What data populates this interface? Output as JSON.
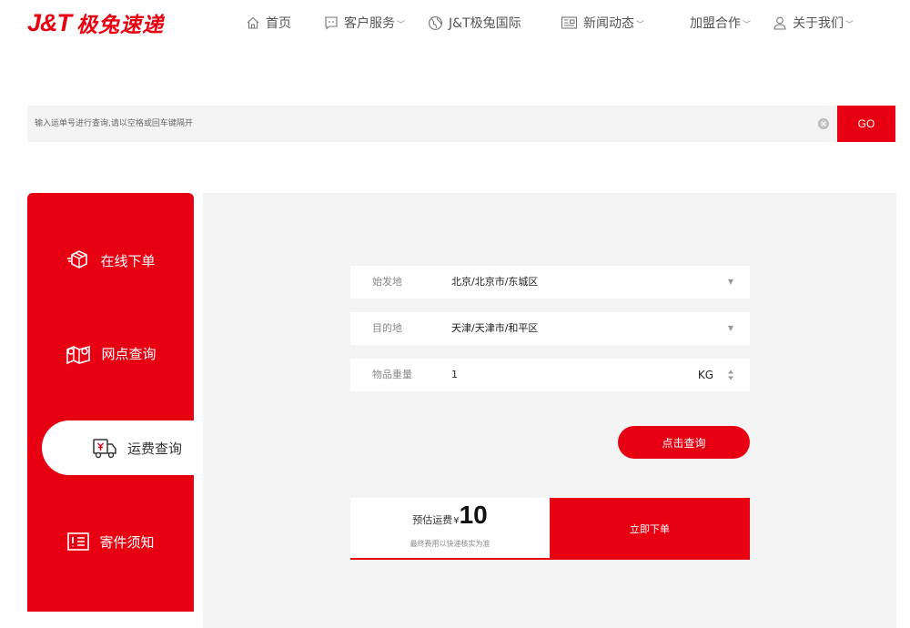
{
  "header": {
    "logo_latin": "J&T",
    "logo_cn": "极兔速递",
    "nav": [
      {
        "label": "首页",
        "icon": "home-icon"
      },
      {
        "label": "客户服务",
        "icon": "chat-icon",
        "dropdown": true
      },
      {
        "label": "J&T极兔国际",
        "icon": "globe-icon"
      },
      {
        "label": "新闻动态",
        "icon": "news-icon",
        "dropdown": true
      },
      {
        "label": "加盟合作",
        "dropdown": true
      },
      {
        "label": "关于我们",
        "icon": "user-icon",
        "dropdown": true
      }
    ],
    "dropdown_glyph": "﹀"
  },
  "search": {
    "placeholder": "输入运单号进行查询,请以空格或回车键隔开",
    "go_label": "GO"
  },
  "sidebar": {
    "items": [
      {
        "label": "在线下单",
        "icon": "package-icon"
      },
      {
        "label": "网点查询",
        "icon": "map-location-icon"
      },
      {
        "label": "运费查询",
        "icon": "delivery-truck-icon",
        "active": true
      },
      {
        "label": "寄件须知",
        "icon": "notice-icon"
      }
    ]
  },
  "form": {
    "origin_label": "始发地",
    "origin_value": "北京/北京市/东城区",
    "destination_label": "目的地",
    "destination_value": "天津/天津市/和平区",
    "weight_label": "物品重量",
    "weight_value": "1",
    "weight_unit": "KG",
    "select_arrow": "▼",
    "query_label": "点击查询"
  },
  "result": {
    "fee_label": "预估运费",
    "currency": "¥",
    "fee_value": "10",
    "note": "最终费用以快递核实为准",
    "order_label": "立即下单"
  },
  "colors": {
    "brand_red": "#e60012",
    "panel_bg": "#f4f4f4"
  }
}
